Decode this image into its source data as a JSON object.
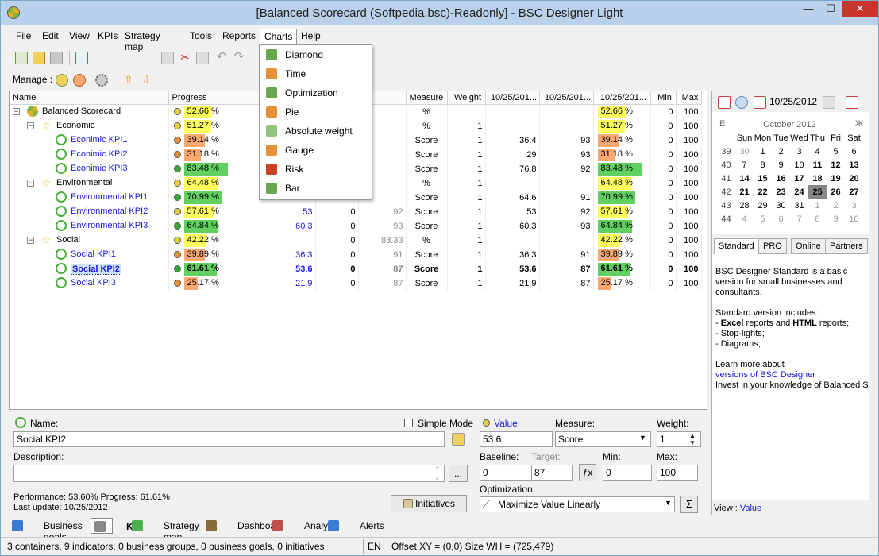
{
  "window": {
    "title": "[Balanced Scorecard (Softpedia.bsc)-Readonly] - BSC Designer Light",
    "minimize": "—",
    "maximize": "☐",
    "close": "✕"
  },
  "menu": [
    "File",
    "Edit",
    "View",
    "KPIs",
    "Strategy map",
    "Tools",
    "Reports",
    "Charts",
    "Help"
  ],
  "toolbar": {
    "manage_label": "Manage :"
  },
  "charts_menu": [
    {
      "label": "Diamond",
      "icon": "diamond-chart-icon",
      "color": "#6aa84f"
    },
    {
      "label": "Time",
      "icon": "time-chart-icon",
      "color": "#e69138"
    },
    {
      "label": "Optimization",
      "icon": "optimization-chart-icon",
      "color": "#6aa84f"
    },
    {
      "label": "Pie",
      "icon": "pie-chart-icon",
      "color": "#e69138"
    },
    {
      "label": "Absolute weight",
      "icon": "absolute-weight-icon",
      "color": "#93c47d"
    },
    {
      "label": "Gauge",
      "icon": "gauge-icon",
      "color": "#e69138"
    },
    {
      "label": "Risk",
      "icon": "risk-icon",
      "color": "#cc4125"
    },
    {
      "label": "Bar",
      "icon": "bar-chart-icon",
      "color": "#6aa84f"
    }
  ],
  "grid": {
    "columns": [
      "Name",
      "Progress",
      "V",
      "",
      "",
      "Measure",
      "Weight",
      "10/25/201...",
      "10/25/201...",
      "10/25/201...",
      "Min",
      "Max"
    ],
    "rows": [
      {
        "name": "Balanced Scorecard",
        "level": 0,
        "kind": "bsc",
        "dot": "#e8d040",
        "progress": "52.66 %",
        "pval": 52.66,
        "pcolor": "#ffff60",
        "value": "",
        "c3": "",
        "c4": "",
        "measure": "%",
        "weight": "",
        "d1": "",
        "d2": "",
        "d3": "52.66 %",
        "min": "0",
        "max": "100"
      },
      {
        "name": "Economic",
        "level": 1,
        "kind": "group",
        "dot": "#e8d040",
        "progress": "51.27 %",
        "pval": 51.27,
        "pcolor": "#ffff60",
        "value": "",
        "c3": "",
        "c4": "",
        "measure": "%",
        "weight": "1",
        "d1": "",
        "d2": "",
        "d3": "51.27 %",
        "min": "0",
        "max": "100"
      },
      {
        "name": "Econimic KPI1",
        "level": 2,
        "kind": "kpi",
        "dot": "#e69138",
        "progress": "39.14 %",
        "pval": 39.14,
        "pcolor": "#f9a870",
        "value": "",
        "c3": "",
        "c4": "",
        "measure": "Score",
        "weight": "1",
        "d1": "36.4",
        "d2": "93",
        "d3": "39.14 %",
        "min": "0",
        "max": "100"
      },
      {
        "name": "Econimic KPI2",
        "level": 2,
        "kind": "kpi",
        "dot": "#e69138",
        "progress": "31.18 %",
        "pval": 31.18,
        "pcolor": "#f9a870",
        "value": "",
        "c3": "",
        "c4": "",
        "measure": "Score",
        "weight": "1",
        "d1": "29",
        "d2": "93",
        "d3": "31.18 %",
        "min": "0",
        "max": "100"
      },
      {
        "name": "Econimic KPI3",
        "level": 2,
        "kind": "kpi",
        "dot": "#38a838",
        "progress": "83.48 %",
        "pval": 83.48,
        "pcolor": "#60d060",
        "value": "",
        "c3": "",
        "c4": "",
        "measure": "Score",
        "weight": "1",
        "d1": "76.8",
        "d2": "92",
        "d3": "83.48 %",
        "min": "0",
        "max": "100"
      },
      {
        "name": "Environmental",
        "level": 1,
        "kind": "group",
        "dot": "#e8d040",
        "progress": "64.48 %",
        "pval": 64.48,
        "pcolor": "#ffff60",
        "value": "",
        "c3": "",
        "c4": "",
        "measure": "%",
        "weight": "1",
        "d1": "",
        "d2": "",
        "d3": "64.48 %",
        "min": "0",
        "max": "100"
      },
      {
        "name": "Environmental KPI1",
        "level": 2,
        "kind": "kpi",
        "dot": "#38a838",
        "progress": "70.99 %",
        "pval": 70.99,
        "pcolor": "#60d060",
        "value": "",
        "c3": "",
        "c4": "",
        "measure": "Score",
        "weight": "1",
        "d1": "64.6",
        "d2": "91",
        "d3": "70.99 %",
        "min": "0",
        "max": "100"
      },
      {
        "name": "Environmental KPI2",
        "level": 2,
        "kind": "kpi",
        "dot": "#e8d040",
        "progress": "57.61 %",
        "pval": 57.61,
        "pcolor": "#ffff60",
        "value": "53",
        "c3": "0",
        "c4": "92",
        "measure": "Score",
        "weight": "1",
        "d1": "53",
        "d2": "92",
        "d3": "57.61 %",
        "min": "0",
        "max": "100"
      },
      {
        "name": "Environmental KPI3",
        "level": 2,
        "kind": "kpi",
        "dot": "#38a838",
        "progress": "64.84 %",
        "pval": 64.84,
        "pcolor": "#60d060",
        "value": "60.3",
        "c3": "0",
        "c4": "93",
        "measure": "Score",
        "weight": "1",
        "d1": "60.3",
        "d2": "93",
        "d3": "64.84 %",
        "min": "0",
        "max": "100"
      },
      {
        "name": "Social",
        "level": 1,
        "kind": "group",
        "dot": "#e8d040",
        "progress": "42.22 %",
        "pval": 42.22,
        "pcolor": "#ffff60",
        "value": "",
        "c3": "0",
        "c4": "88.33",
        "measure": "%",
        "weight": "1",
        "d1": "",
        "d2": "",
        "d3": "42.22 %",
        "min": "0",
        "max": "100"
      },
      {
        "name": "Social KPI1",
        "level": 2,
        "kind": "kpi",
        "dot": "#e69138",
        "progress": "39.89 %",
        "pval": 39.89,
        "pcolor": "#f9a870",
        "value": "36.3",
        "c3": "0",
        "c4": "91",
        "measure": "Score",
        "weight": "1",
        "d1": "36.3",
        "d2": "91",
        "d3": "39.89 %",
        "min": "0",
        "max": "100"
      },
      {
        "name": "Social KPI2",
        "level": 2,
        "kind": "kpi",
        "dot": "#38a838",
        "progress": "61.61 %",
        "pval": 61.61,
        "pcolor": "#60d060",
        "value": "53.6",
        "c3": "0",
        "c4": "87",
        "measure": "Score",
        "weight": "1",
        "d1": "53.6",
        "d2": "87",
        "d3": "61.61 %",
        "min": "0",
        "max": "100",
        "selected": true
      },
      {
        "name": "Social KPI3",
        "level": 2,
        "kind": "kpi",
        "dot": "#e69138",
        "progress": "25.17 %",
        "pval": 25.17,
        "pcolor": "#f9a870",
        "value": "21.9",
        "c3": "0",
        "c4": "87",
        "measure": "Score",
        "weight": "1",
        "d1": "21.9",
        "d2": "87",
        "d3": "25.17 %",
        "min": "0",
        "max": "100"
      }
    ]
  },
  "calendar": {
    "date": "10/25/2012",
    "month": "October 2012",
    "prev_mark": "E",
    "next_mark": "Ж",
    "days": [
      "Sun",
      "Mon",
      "Tue",
      "Wed",
      "Thu",
      "Fri",
      "Sat"
    ],
    "weeks": [
      [
        "39",
        "30",
        "1",
        "2",
        "3",
        "4",
        "5",
        "6"
      ],
      [
        "40",
        "7",
        "8",
        "9",
        "10",
        "11",
        "12",
        "13"
      ],
      [
        "41",
        "14",
        "15",
        "16",
        "17",
        "18",
        "19",
        "20"
      ],
      [
        "42",
        "21",
        "22",
        "23",
        "24",
        "25",
        "26",
        "27"
      ],
      [
        "43",
        "28",
        "29",
        "30",
        "31",
        "1",
        "2",
        "3"
      ],
      [
        "44",
        "4",
        "5",
        "6",
        "7",
        "8",
        "9",
        "10"
      ]
    ],
    "today": "25"
  },
  "side_tabs": [
    "Standard",
    "PRO",
    "Online",
    "Partners"
  ],
  "info": {
    "p1": "BSC Designer Standard is a basic version for small businesses and consultants.",
    "p2": "Standard version includes:",
    "b1a": "- ",
    "b1b": "Excel",
    "b1c": " reports and ",
    "b1d": "HTML",
    "b1e": " reports;",
    "b2": "- Stop-lights;",
    "b3": "- Diagrams;",
    "p3": "Learn more about",
    "link": "versions of BSC Designer",
    "p4": "Invest in your knowledge of Balanced Sc",
    "view_label": "View : ",
    "view_link": "Value"
  },
  "editor": {
    "name_label": "Name:",
    "name": "Social KPI2",
    "simple_mode": "Simple Mode",
    "description_label": "Description:",
    "description": "",
    "ellipsis": "...",
    "value_label": "Value:",
    "value": "53.6",
    "measure_label": "Measure:",
    "measure": "Score",
    "weight_label": "Weight:",
    "weight": "1",
    "baseline_label": "Baseline:",
    "baseline": "0",
    "target_label": "Target:",
    "target": "87",
    "min_label": "Min:",
    "min": "0",
    "max_label": "Max:",
    "max": "100",
    "optimization_label": "Optimization:",
    "optimization": "Maximize Value Linearly",
    "performance": "Performance: 53.60%  Progress: 61.61%",
    "last_update": "Last update: 10/25/2012",
    "initiatives": "Initiatives"
  },
  "bottom_tabs": [
    {
      "label": "Business goals",
      "icon": "business-goals-icon",
      "color": "#3a7bd5"
    },
    {
      "label": "KPI",
      "icon": "kpi-list-icon",
      "color": "#888888"
    },
    {
      "label": "Strategy map",
      "icon": "strategy-map-icon",
      "color": "#4caf50"
    },
    {
      "label": "Dashboard",
      "icon": "dashboard-icon",
      "color": "#8a6a3a"
    },
    {
      "label": "Analysis",
      "icon": "analysis-icon",
      "color": "#c05050"
    },
    {
      "label": "Alerts",
      "icon": "alerts-icon",
      "color": "#3a7bd5"
    }
  ],
  "status": {
    "summary": "3 containers, 9 indicators, 0 business groups, 0 business goals, 0 initiatives",
    "lang": "EN",
    "offset": "Offset XY = (0,0) Size WH = (725,479)"
  }
}
